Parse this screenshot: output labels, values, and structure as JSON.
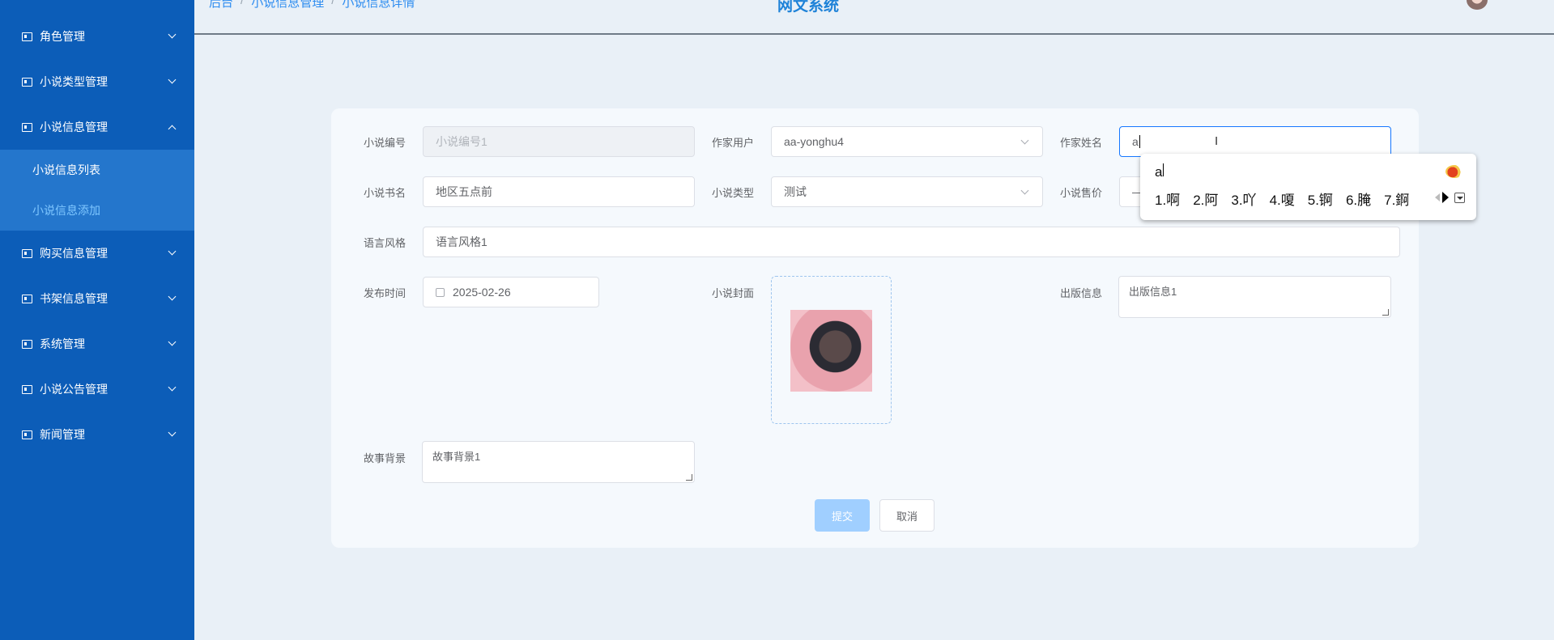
{
  "header": {
    "breadcrumb": [
      "后台",
      "小说信息管理",
      "小说信息详情"
    ],
    "breadcrumb_sep": "/",
    "title": "网文系统"
  },
  "sidebar": {
    "items": [
      {
        "label": "角色管理"
      },
      {
        "label": "小说类型管理"
      },
      {
        "label": "小说信息管理"
      },
      {
        "label": "购买信息管理"
      },
      {
        "label": "书架信息管理"
      },
      {
        "label": "系统管理"
      },
      {
        "label": "小说公告管理"
      },
      {
        "label": "新闻管理"
      }
    ],
    "subitems": [
      {
        "label": "小说信息列表"
      },
      {
        "label": "小说信息添加"
      }
    ]
  },
  "form": {
    "novel_no": {
      "label": "小说编号",
      "placeholder": "小说编号1"
    },
    "author_user": {
      "label": "作家用户",
      "value": "aa-yonghu4"
    },
    "author_name": {
      "label": "作家姓名",
      "value": "a"
    },
    "book_name": {
      "label": "小说书名",
      "value": "地区五点前"
    },
    "novel_type": {
      "label": "小说类型",
      "value": "测试"
    },
    "price": {
      "label": "小说售价",
      "value": "—"
    },
    "style": {
      "label": "语言风格",
      "value": "语言风格1"
    },
    "publish_time": {
      "label": "发布时间",
      "value": "2025-02-26"
    },
    "cover": {
      "label": "小说封面"
    },
    "publish_info": {
      "label": "出版信息",
      "value": "出版信息1"
    },
    "background": {
      "label": "故事背景",
      "value": "故事背景1"
    },
    "submit_label": "提交",
    "cancel_label": "取消"
  },
  "ime": {
    "composition": "a",
    "candidates": [
      "1.啊",
      "2.阿",
      "3.吖",
      "4.嗄",
      "5.锕",
      "6.腌",
      "7.錒"
    ]
  },
  "colors": {
    "sidebar": "#0c5db8",
    "accent": "#1677ff",
    "submit": "#a0cfff"
  }
}
